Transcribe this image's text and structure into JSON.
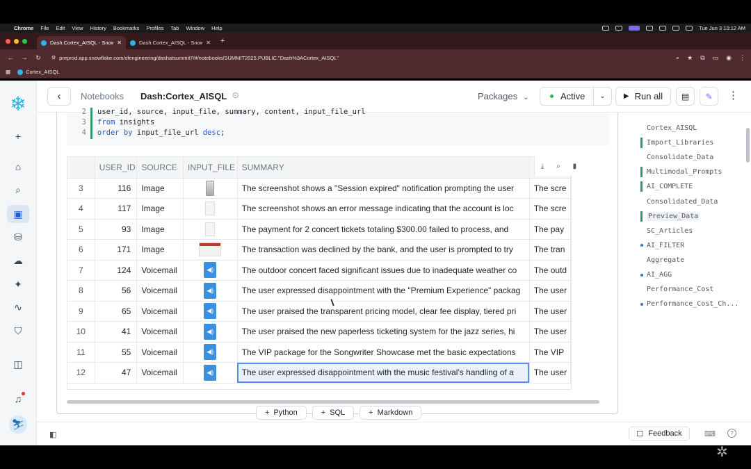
{
  "menubar": {
    "apple": "",
    "items": [
      "Chrome",
      "File",
      "Edit",
      "View",
      "History",
      "Bookmarks",
      "Profiles",
      "Tab",
      "Window",
      "Help"
    ],
    "datetime": "Tue Jun 3  10:12 AM"
  },
  "browser": {
    "tabs": [
      {
        "title": "Dash:Cortex_AISQL - Snowfla"
      },
      {
        "title": "Dash:Cortex_AISQL - Snowfla"
      }
    ],
    "url": "preprod.app.snowflake.com/sfengineering/dashatsummit7/#/notebooks/SUMMIT2025.PUBLIC.\"Dash%3ACortex_AISQL\"",
    "bookmark": "Cortex_AISQL"
  },
  "topbar": {
    "crumb": "Notebooks",
    "title": "Dash:Cortex_AISQL",
    "packages": "Packages",
    "status": "Active",
    "run_all": "Run all"
  },
  "code": {
    "lines": [
      {
        "no": "2",
        "text": "    user_id, source, input_file, summary, content, input_file_url"
      },
      {
        "no": "3",
        "kw": "from",
        "rest": " insights"
      },
      {
        "no": "4",
        "kw": "order by",
        "rest": " input_file_url ",
        "kw2": "desc",
        "end": ";"
      }
    ]
  },
  "table": {
    "headers": [
      "",
      "USER_ID",
      "SOURCE",
      "INPUT_FILE",
      "SUMMARY",
      ""
    ],
    "rows": [
      {
        "idx": "3",
        "user_id": "116",
        "source": "Image",
        "thumb": "phone",
        "summary": "The screenshot shows a \"Session expired\" notification prompting the user",
        "content": "The scre"
      },
      {
        "idx": "4",
        "user_id": "117",
        "source": "Image",
        "thumb": "doc",
        "summary": "The screenshot shows an error message indicating that the account is loc",
        "content": "The scre"
      },
      {
        "idx": "5",
        "user_id": "93",
        "source": "Image",
        "thumb": "doc",
        "summary": "The payment for 2 concert tickets totaling $300.00 failed to process, and",
        "content": "The pay"
      },
      {
        "idx": "6",
        "user_id": "171",
        "source": "Image",
        "thumb": "wide",
        "summary": "The transaction was declined by the bank, and the user is prompted to try",
        "content": "The tran"
      },
      {
        "idx": "7",
        "user_id": "124",
        "source": "Voicemail",
        "thumb": "audio",
        "summary": "The outdoor concert faced significant issues due to inadequate weather co",
        "content": "The outd"
      },
      {
        "idx": "8",
        "user_id": "56",
        "source": "Voicemail",
        "thumb": "audio",
        "summary": "The user expressed disappointment with the \"Premium Experience\" packag",
        "content": "The user"
      },
      {
        "idx": "9",
        "user_id": "65",
        "source": "Voicemail",
        "thumb": "audio",
        "summary": "The user praised the transparent pricing model, clear fee display, tiered pri",
        "content": "The user"
      },
      {
        "idx": "10",
        "user_id": "41",
        "source": "Voicemail",
        "thumb": "audio",
        "summary": "The user praised the new paperless ticketing system for the jazz series, hi",
        "content": "The user"
      },
      {
        "idx": "11",
        "user_id": "55",
        "source": "Voicemail",
        "thumb": "audio",
        "summary": "The VIP package for the Songwriter Showcase met the basic expectations",
        "content": "The VIP"
      },
      {
        "idx": "12",
        "user_id": "47",
        "source": "Voicemail",
        "thumb": "audio",
        "summary": "The user expressed disappointment with the music festival's handling of a",
        "content": "The user",
        "selected": true
      }
    ]
  },
  "add_buttons": {
    "python": "Python",
    "sql": "SQL",
    "markdown": "Markdown"
  },
  "outline": [
    {
      "label": "Cortex_AISQL",
      "mark": "none"
    },
    {
      "label": "Import_Libraries",
      "mark": "green"
    },
    {
      "label": "Consolidate_Data",
      "mark": "none"
    },
    {
      "label": "Multimodal_Prompts",
      "mark": "green"
    },
    {
      "label": "AI_COMPLETE",
      "mark": "green"
    },
    {
      "label": "Consolidated_Data",
      "mark": "none"
    },
    {
      "label": "Preview_Data",
      "mark": "green",
      "selected": true
    },
    {
      "label": "SC_Articles",
      "mark": "none"
    },
    {
      "label": "AI_FILTER",
      "mark": "dot"
    },
    {
      "label": "Aggregate",
      "mark": "none"
    },
    {
      "label": "AI_AGG",
      "mark": "dot"
    },
    {
      "label": "Performance_Cost",
      "mark": "none"
    },
    {
      "label": "Performance_Cost_Ch...",
      "mark": "dot"
    }
  ],
  "footer": {
    "feedback": "Feedback"
  },
  "colors": {
    "accent": "#29b5e8",
    "active_dot": "#2fb34a",
    "selection": "#5b8de8",
    "browser_chrome": "#4f2a2e"
  }
}
